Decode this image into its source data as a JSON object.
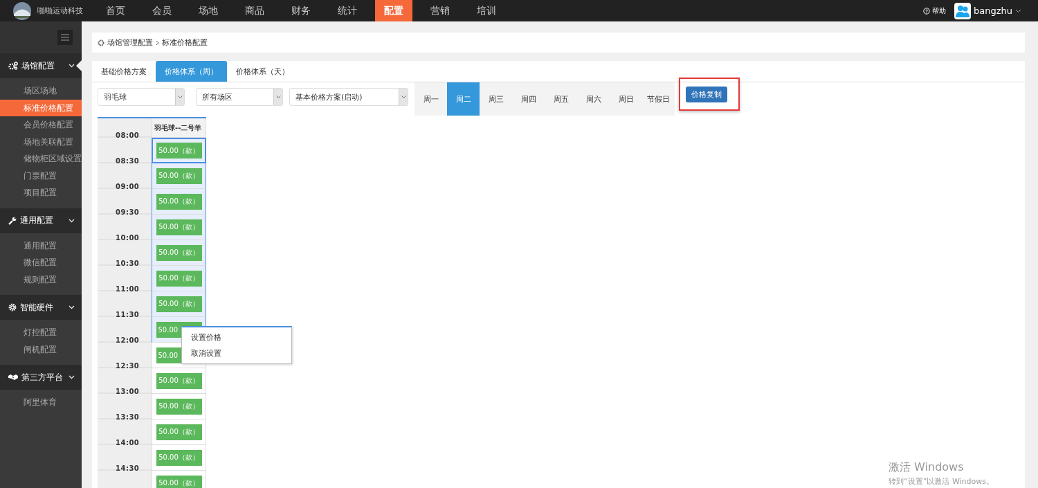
{
  "brand": "啪啪运动科技",
  "nav": [
    {
      "label": "首页",
      "selected": false
    },
    {
      "label": "会员",
      "selected": false
    },
    {
      "label": "场地",
      "selected": false
    },
    {
      "label": "商品",
      "selected": false
    },
    {
      "label": "财务",
      "selected": false
    },
    {
      "label": "统计",
      "selected": false
    },
    {
      "label": "配置",
      "selected": true
    },
    {
      "label": "营销",
      "selected": false
    },
    {
      "label": "培训",
      "selected": false
    }
  ],
  "help": "帮助",
  "user": "bangzhu",
  "sidebar": [
    {
      "title": "场馆配置",
      "expanded": true,
      "items": [
        {
          "label": "场区场地",
          "selected": false
        },
        {
          "label": "标准价格配置",
          "selected": true
        },
        {
          "label": "会员价格配置",
          "selected": false
        },
        {
          "label": "场地关联配置",
          "selected": false
        },
        {
          "label": "储物柜区域设置",
          "selected": false
        },
        {
          "label": "门票配置",
          "selected": false
        },
        {
          "label": "项目配置",
          "selected": false
        }
      ]
    },
    {
      "title": "通用配置",
      "expanded": true,
      "items": [
        {
          "label": "通用配置",
          "selected": false
        },
        {
          "label": "微信配置",
          "selected": false
        },
        {
          "label": "规则配置",
          "selected": false
        }
      ]
    },
    {
      "title": "智能硬件",
      "expanded": true,
      "items": [
        {
          "label": "灯控配置",
          "selected": false
        },
        {
          "label": "闸机配置",
          "selected": false
        }
      ]
    },
    {
      "title": "第三方平台",
      "expanded": true,
      "items": [
        {
          "label": "阿里体育",
          "selected": false
        }
      ]
    }
  ],
  "breadcrumb": [
    "场馆管理配置",
    "标准价格配置"
  ],
  "tabs": [
    {
      "label": "基础价格方案",
      "selected": false
    },
    {
      "label": "价格体系（周）",
      "selected": true
    },
    {
      "label": "价格体系（天）",
      "selected": false
    }
  ],
  "selects": [
    "羽毛球",
    "所有场区",
    "基本价格方案(启动)"
  ],
  "days": [
    {
      "label": "周一",
      "selected": false
    },
    {
      "label": "周二",
      "selected": true
    },
    {
      "label": "周三",
      "selected": false
    },
    {
      "label": "周四",
      "selected": false
    },
    {
      "label": "周五",
      "selected": false
    },
    {
      "label": "周六",
      "selected": false
    },
    {
      "label": "周日",
      "selected": false
    },
    {
      "label": "节假日",
      "selected": false
    }
  ],
  "copy_button": "价格复制",
  "grid": {
    "court": "羽毛球--二号羊",
    "rows": [
      {
        "time": "08:00",
        "price": "50.00（款）",
        "selected": true
      },
      {
        "time": "08:30",
        "price": "50.00（款）",
        "selected": true
      },
      {
        "time": "09:00",
        "price": "50.00（款）",
        "selected": true
      },
      {
        "time": "09:30",
        "price": "50.00（款）",
        "selected": true
      },
      {
        "time": "10:00",
        "price": "50.00（款）",
        "selected": true
      },
      {
        "time": "10:30",
        "price": "50.00（款）",
        "selected": true
      },
      {
        "time": "11:00",
        "price": "50.00（款）",
        "selected": true
      },
      {
        "time": "11:30",
        "price": "50.00",
        "selected": true
      },
      {
        "time": "12:00",
        "price": "50.00",
        "selected": false
      },
      {
        "time": "12:30",
        "price": "50.00（款）",
        "selected": false
      },
      {
        "time": "13:00",
        "price": "50.00（款）",
        "selected": false
      },
      {
        "time": "13:30",
        "price": "50.00（款）",
        "selected": false
      },
      {
        "time": "14:00",
        "price": "50.00（款）",
        "selected": false
      },
      {
        "time": "14:30",
        "price": "50.00（款）",
        "selected": false
      }
    ]
  },
  "context_menu": [
    "设置价格",
    "取消设置"
  ],
  "watermark": {
    "title": "激活 Windows",
    "hint": "转到“设置”以激活 Windows。"
  }
}
